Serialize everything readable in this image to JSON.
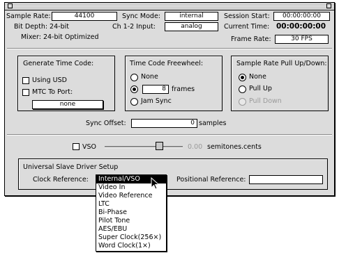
{
  "top": {
    "sample_rate_label": "Sample Rate:",
    "sample_rate_value": "44100",
    "bit_depth": "Bit Depth: 24-bit",
    "mixer": "Mixer: 24-bit Optimized",
    "sync_mode_label": "Sync Mode:",
    "sync_mode_value": "internal",
    "ch_input_label": "Ch 1-2 Input:",
    "ch_input_value": "analog",
    "session_start_label": "Session Start:",
    "session_start_value": "00:00:00:00",
    "current_time_label": "Current Time:",
    "current_time_value": "00:00:00:00",
    "frame_rate_label": "Frame Rate:",
    "frame_rate_value": "30 FPS"
  },
  "generate": {
    "title": "Generate Time Code:",
    "using_usd": "Using USD",
    "mtc_to_port": "MTC To Port:",
    "port_value": "none"
  },
  "freewheel": {
    "title": "Time Code Freewheel:",
    "none": "None",
    "frames_value": "8",
    "frames_label": "frames",
    "jam_sync": "Jam Sync"
  },
  "pullupdown": {
    "title": "Sample Rate Pull Up/Down:",
    "none": "None",
    "pull_up": "Pull Up",
    "pull_down": "Pull Down"
  },
  "sync_offset": {
    "label": "Sync Offset:",
    "value": "0",
    "unit": "samples"
  },
  "vso": {
    "label": "VSO",
    "readout": "0.00",
    "unit": "semitones.cents"
  },
  "usd": {
    "title": "Universal Slave Driver Setup",
    "clock_ref_label": "Clock Reference:",
    "pos_ref_label": "Positional Reference:",
    "pos_ref_value": ""
  },
  "clock_menu": {
    "items": [
      "Internal/VSO",
      "Video In",
      "Video Reference",
      "LTC",
      "Bi-Phase",
      "Pilot Tone",
      "AES/EBU",
      "Super Clock(256×)",
      "Word Clock(1×)"
    ]
  }
}
